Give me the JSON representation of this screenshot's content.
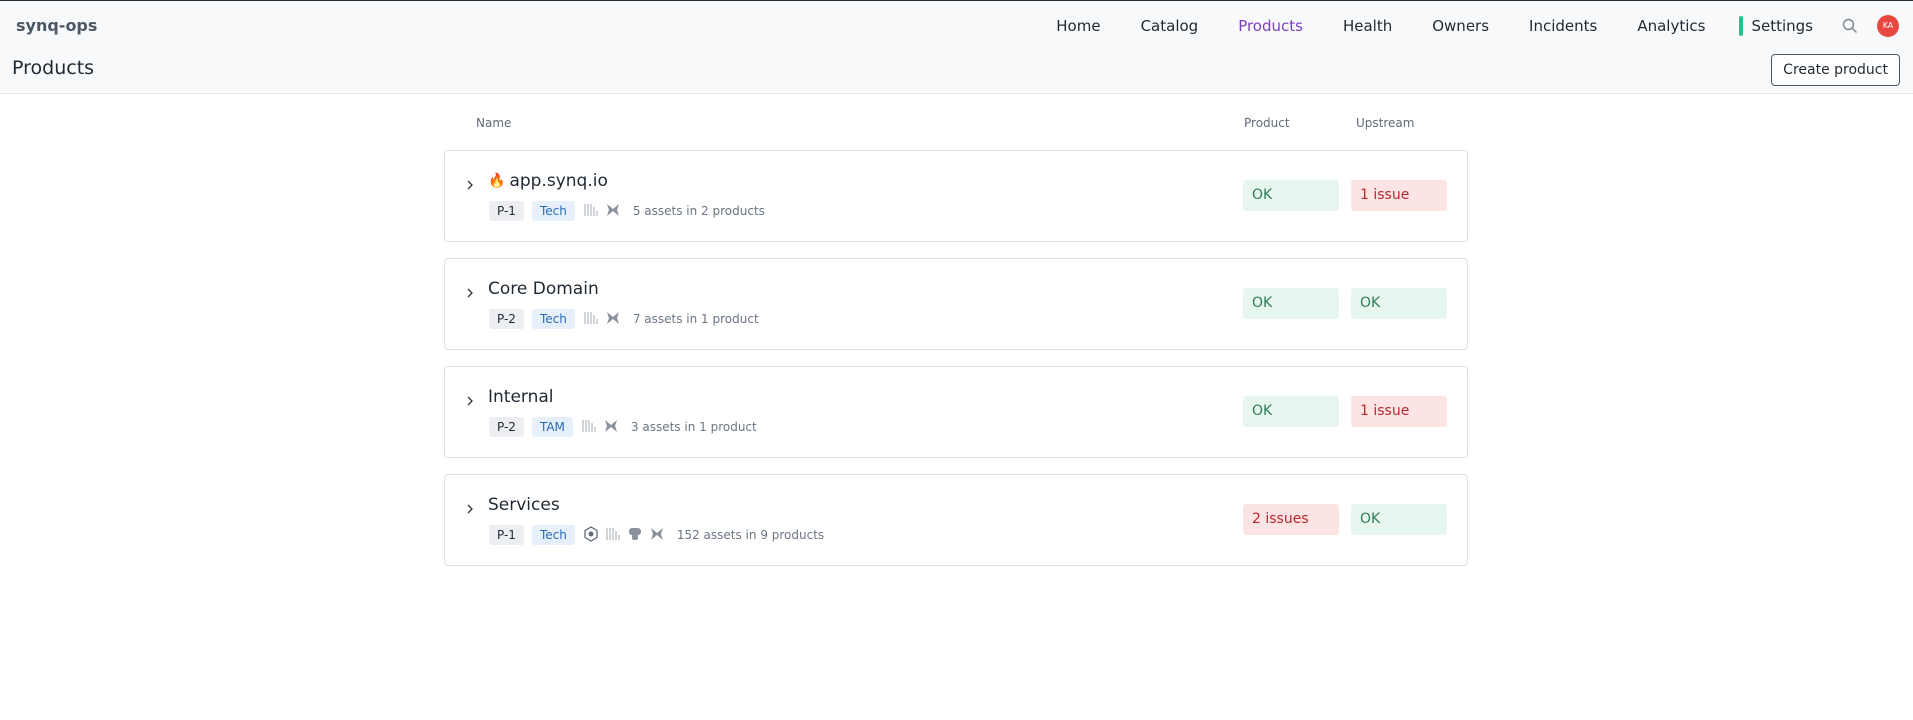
{
  "app": {
    "brand": "synq-ops"
  },
  "nav": {
    "items": [
      "Home",
      "Catalog",
      "Products",
      "Health",
      "Owners",
      "Incidents",
      "Analytics"
    ],
    "active": "Products",
    "settings": "Settings",
    "avatar_initials": "KA"
  },
  "page": {
    "title": "Products",
    "create_label": "Create product"
  },
  "table": {
    "columns": {
      "name": "Name",
      "product": "Product",
      "upstream": "Upstream"
    },
    "rows": [
      {
        "name": "app.synq.io",
        "flame": "🔥",
        "priority": "P-1",
        "team": "Tech",
        "assets": "5 assets in 2 products",
        "product_status": "OK",
        "product_state": "ok",
        "upstream_status": "1 issue",
        "upstream_state": "bad"
      },
      {
        "name": "Core Domain",
        "priority": "P-2",
        "team": "Tech",
        "assets": "7 assets in 1 product",
        "product_status": "OK",
        "product_state": "ok",
        "upstream_status": "OK",
        "upstream_state": "ok"
      },
      {
        "name": "Internal",
        "priority": "P-2",
        "team": "TAM",
        "assets": "3 assets in 1 product",
        "product_status": "OK",
        "product_state": "ok",
        "upstream_status": "1 issue",
        "upstream_state": "bad"
      },
      {
        "name": "Services",
        "priority": "P-1",
        "team": "Tech",
        "assets": "152 assets in 9 products",
        "product_status": "2 issues",
        "product_state": "bad",
        "upstream_status": "OK",
        "upstream_state": "ok"
      }
    ]
  }
}
